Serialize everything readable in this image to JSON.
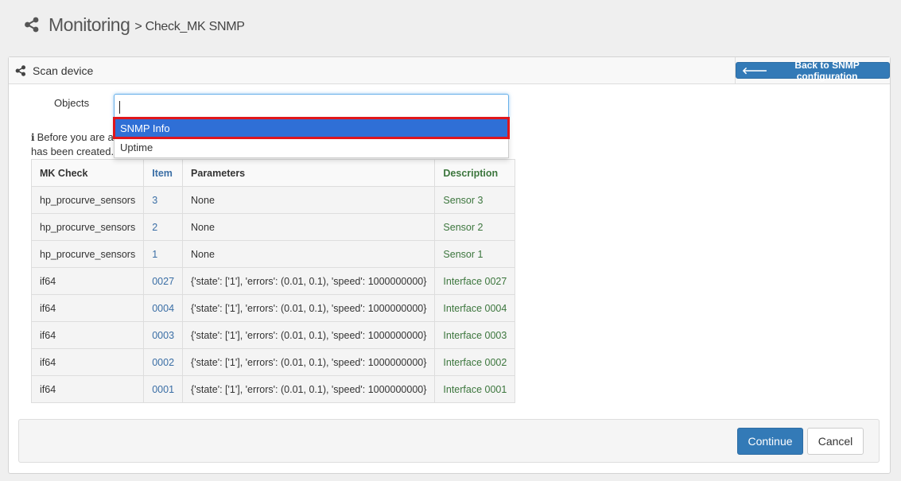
{
  "header": {
    "title": "Monitoring",
    "subtitle": "> Check_MK SNMP",
    "icon": "share-icon"
  },
  "panel": {
    "title": "Scan device",
    "icon": "share-icon",
    "back_button": "Back to SNMP configuration",
    "back_icon": "arrow-left-icon"
  },
  "form": {
    "objects_label": "Objects",
    "objects_value": ""
  },
  "dropdown": {
    "items": [
      "SNMP Info",
      "Uptime"
    ],
    "highlighted": "SNMP Info",
    "highlight_color": "#e0161c"
  },
  "info": {
    "icon": "info-icon",
    "line1": "Before you are a",
    "line2": "has been created."
  },
  "table": {
    "headers": [
      "MK Check",
      "Item",
      "Parameters",
      "Description"
    ],
    "rows": [
      [
        "hp_procurve_sensors",
        "3",
        "None",
        "Sensor 3"
      ],
      [
        "hp_procurve_sensors",
        "2",
        "None",
        "Sensor 2"
      ],
      [
        "hp_procurve_sensors",
        "1",
        "None",
        "Sensor 1"
      ],
      [
        "if64",
        "0027",
        "{'state': ['1'], 'errors': (0.01, 0.1), 'speed': 1000000000}",
        "Interface 0027"
      ],
      [
        "if64",
        "0004",
        "{'state': ['1'], 'errors': (0.01, 0.1), 'speed': 1000000000}",
        "Interface 0004"
      ],
      [
        "if64",
        "0003",
        "{'state': ['1'], 'errors': (0.01, 0.1), 'speed': 1000000000}",
        "Interface 0003"
      ],
      [
        "if64",
        "0002",
        "{'state': ['1'], 'errors': (0.01, 0.1), 'speed': 1000000000}",
        "Interface 0002"
      ],
      [
        "if64",
        "0001",
        "{'state': ['1'], 'errors': (0.01, 0.1), 'speed': 1000000000}",
        "Interface 0001"
      ]
    ]
  },
  "footer": {
    "continue_label": "Continue",
    "cancel_label": "Cancel"
  },
  "colors": {
    "primary": "#337ab7",
    "item_link": "#3a6ea5",
    "description": "#3c763d"
  }
}
